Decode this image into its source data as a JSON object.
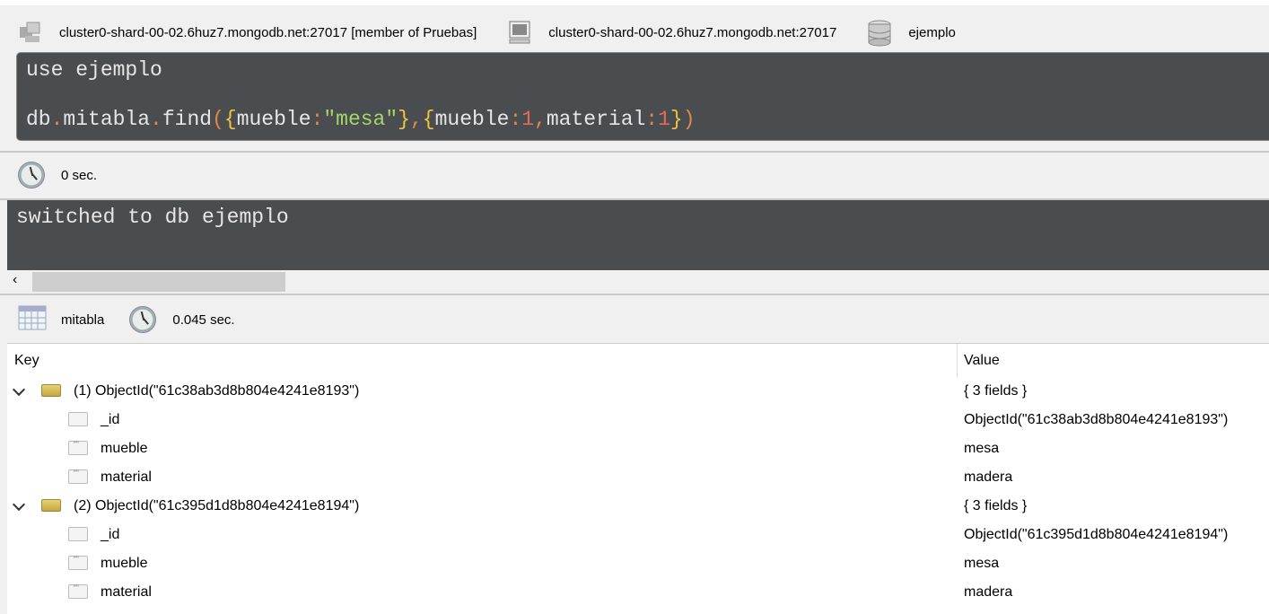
{
  "connection": {
    "server": "cluster0-shard-00-02.6huz7.mongodb.net:27017 [member of Pruebas]",
    "host": "cluster0-shard-00-02.6huz7.mongodb.net:27017",
    "database": "ejemplo"
  },
  "editor": {
    "line1": "use ejemplo",
    "line2": {
      "a": "db",
      "b": ".",
      "c": "mitabla",
      "d": ".",
      "e": "find",
      "f": "(",
      "g": "{",
      "h": "mueble",
      "i": ":",
      "j": "\"mesa\"",
      "k": "}",
      "l": ",",
      "m": "{",
      "n": "mueble",
      "o": ":",
      "p": "1",
      "q": ",",
      "r": "material",
      "s": ":",
      "t": "1",
      "u": "}",
      "v": ")"
    }
  },
  "exec1": {
    "time": "0 sec."
  },
  "output": {
    "text": "switched to db ejemplo"
  },
  "exec2": {
    "collection": "mitabla",
    "time": "0.045 sec."
  },
  "tree": {
    "key_header": "Key",
    "value_header": "Value",
    "documents": [
      {
        "key": "(1) ObjectId(\"61c38ab3d8b804e4241e8193\")",
        "value": "{ 3 fields }",
        "fields": [
          {
            "key": "_id",
            "value": "ObjectId(\"61c38ab3d8b804e4241e8193\")",
            "type": "objectid"
          },
          {
            "key": "mueble",
            "value": "mesa",
            "type": "string"
          },
          {
            "key": "material",
            "value": "madera",
            "type": "string"
          }
        ]
      },
      {
        "key": "(2) ObjectId(\"61c395d1d8b804e4241e8194\")",
        "value": "{ 3 fields }",
        "fields": [
          {
            "key": "_id",
            "value": "ObjectId(\"61c395d1d8b804e4241e8194\")",
            "type": "objectid"
          },
          {
            "key": "mueble",
            "value": "mesa",
            "type": "string"
          },
          {
            "key": "material",
            "value": "madera",
            "type": "string"
          }
        ]
      }
    ]
  }
}
